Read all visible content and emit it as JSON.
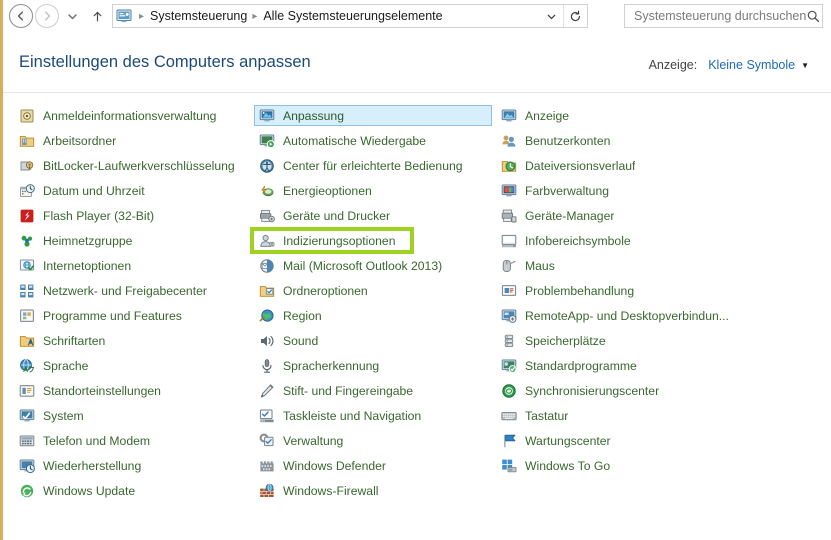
{
  "window": {
    "nav": {
      "back_tooltip": "Zurück",
      "forward_tooltip": "Vorwärts",
      "recent_tooltip": "Zuletzt besuchte Seiten",
      "up_tooltip": "Nach oben"
    },
    "address_bar": {
      "icon": "control-panel-icon",
      "separator": "▸",
      "crumbs": [
        "Systemsteuerung",
        "Alle Systemsteuerungselemente"
      ],
      "dropdown_glyph": "⌄",
      "refresh_glyph": "↻"
    },
    "search": {
      "placeholder": "Systemsteuerung durchsuchen",
      "icon": "search-icon"
    }
  },
  "header": {
    "title": "Einstellungen des Computers anpassen",
    "view": {
      "label": "Anzeige:",
      "value": "Kleine Symbole",
      "arrow": "▼"
    }
  },
  "annotation": {
    "color": "#9fd321",
    "target": "Indizierungsoptionen"
  },
  "selection": {
    "item": "Anpassung",
    "fill": "#d7effc",
    "border": "#8ec2dd"
  },
  "colors": {
    "item_text": "#39672f",
    "title_text": "#1c4a7a",
    "link_text": "#1c6bb5",
    "edge_stripe": "#d9ad5c"
  },
  "columns": [
    {
      "items": [
        {
          "label": "Anmeldeinformationsverwaltung",
          "icon": "credential-manager-icon"
        },
        {
          "label": "Arbeitsordner",
          "icon": "work-folders-icon"
        },
        {
          "label": "BitLocker-Laufwerkverschlüsselung",
          "icon": "bitlocker-icon"
        },
        {
          "label": "Datum und Uhrzeit",
          "icon": "date-time-icon"
        },
        {
          "label": "Flash Player (32-Bit)",
          "icon": "flash-player-icon"
        },
        {
          "label": "Heimnetzgruppe",
          "icon": "homegroup-icon"
        },
        {
          "label": "Internetoptionen",
          "icon": "internet-options-icon"
        },
        {
          "label": "Netzwerk- und Freigabecenter",
          "icon": "network-sharing-icon"
        },
        {
          "label": "Programme und Features",
          "icon": "programs-features-icon"
        },
        {
          "label": "Schriftarten",
          "icon": "fonts-icon"
        },
        {
          "label": "Sprache",
          "icon": "language-icon"
        },
        {
          "label": "Standorteinstellungen",
          "icon": "location-settings-icon"
        },
        {
          "label": "System",
          "icon": "system-icon"
        },
        {
          "label": "Telefon und Modem",
          "icon": "phone-modem-icon"
        },
        {
          "label": "Wiederherstellung",
          "icon": "recovery-icon"
        },
        {
          "label": "Windows Update",
          "icon": "windows-update-icon"
        }
      ]
    },
    {
      "items": [
        {
          "label": "Anpassung",
          "icon": "personalization-icon",
          "selected": true
        },
        {
          "label": "Automatische Wiedergabe",
          "icon": "autoplay-icon"
        },
        {
          "label": "Center für erleichterte Bedienung",
          "icon": "ease-of-access-icon"
        },
        {
          "label": "Energieoptionen",
          "icon": "power-options-icon"
        },
        {
          "label": "Geräte und Drucker",
          "icon": "devices-printers-icon"
        },
        {
          "label": "Indizierungsoptionen",
          "icon": "indexing-options-icon",
          "annotated": true
        },
        {
          "label": "Mail (Microsoft Outlook 2013)",
          "icon": "mail-icon"
        },
        {
          "label": "Ordneroptionen",
          "icon": "folder-options-icon"
        },
        {
          "label": "Region",
          "icon": "region-icon"
        },
        {
          "label": "Sound",
          "icon": "sound-icon"
        },
        {
          "label": "Spracherkennung",
          "icon": "speech-recognition-icon"
        },
        {
          "label": "Stift- und Fingereingabe",
          "icon": "pen-touch-icon"
        },
        {
          "label": "Taskleiste und Navigation",
          "icon": "taskbar-navigation-icon"
        },
        {
          "label": "Verwaltung",
          "icon": "administrative-tools-icon"
        },
        {
          "label": "Windows Defender",
          "icon": "windows-defender-icon"
        },
        {
          "label": "Windows-Firewall",
          "icon": "windows-firewall-icon"
        }
      ]
    },
    {
      "items": [
        {
          "label": "Anzeige",
          "icon": "display-icon"
        },
        {
          "label": "Benutzerkonten",
          "icon": "user-accounts-icon"
        },
        {
          "label": "Dateiversionsverlauf",
          "icon": "file-history-icon"
        },
        {
          "label": "Farbverwaltung",
          "icon": "color-management-icon"
        },
        {
          "label": "Geräte-Manager",
          "icon": "device-manager-icon"
        },
        {
          "label": "Infobereichsymbole",
          "icon": "notification-area-icon"
        },
        {
          "label": "Maus",
          "icon": "mouse-icon"
        },
        {
          "label": "Problembehandlung",
          "icon": "troubleshooting-icon"
        },
        {
          "label": "RemoteApp- und Desktopverbindun...",
          "icon": "remoteapp-icon"
        },
        {
          "label": "Speicherplätze",
          "icon": "storage-spaces-icon"
        },
        {
          "label": "Standardprogramme",
          "icon": "default-programs-icon"
        },
        {
          "label": "Synchronisierungscenter",
          "icon": "sync-center-icon"
        },
        {
          "label": "Tastatur",
          "icon": "keyboard-icon"
        },
        {
          "label": "Wartungscenter",
          "icon": "action-center-icon"
        },
        {
          "label": "Windows To Go",
          "icon": "windows-to-go-icon"
        }
      ]
    }
  ]
}
